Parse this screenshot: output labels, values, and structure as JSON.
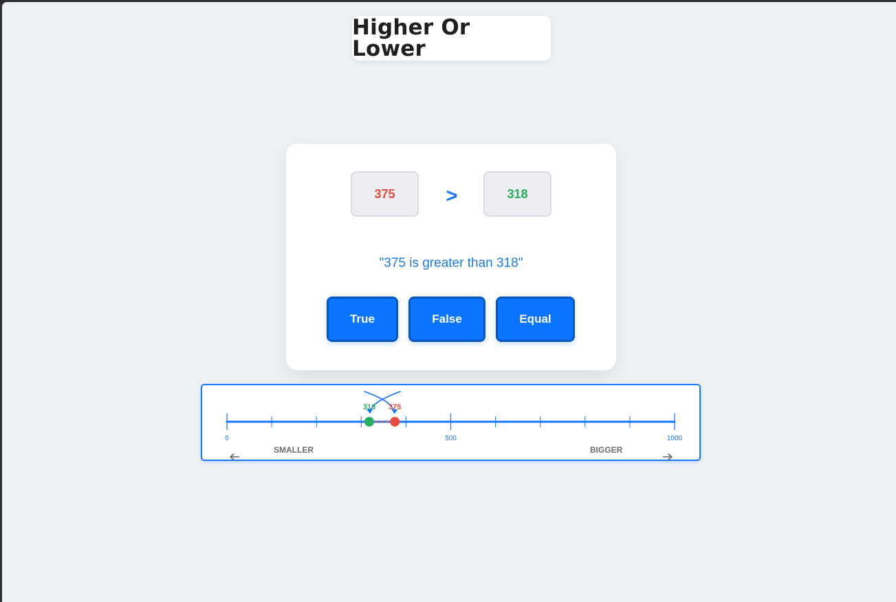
{
  "header": {
    "title": "Higher Or Lower"
  },
  "game": {
    "left_number": "375",
    "comparison_symbol": ">",
    "right_number": "318",
    "statement": "\"375 is greater than 318\"",
    "buttons": [
      {
        "label": "True"
      },
      {
        "label": "False"
      },
      {
        "label": "Equal"
      }
    ]
  },
  "number_line": {
    "min_label": "0",
    "mid_label": "500",
    "max_label": "1000",
    "left_caption": "SMALLER",
    "right_caption": "BIGGER",
    "points": [
      {
        "label": "318",
        "value": 318,
        "color": "#27ae60"
      },
      {
        "label": "375",
        "value": 375,
        "color": "#e74c3c"
      }
    ]
  },
  "colors": {
    "accent": "#1677ff",
    "left_value": "#e74c3c",
    "right_value": "#27ae60",
    "page_background": "#eef1f4"
  }
}
